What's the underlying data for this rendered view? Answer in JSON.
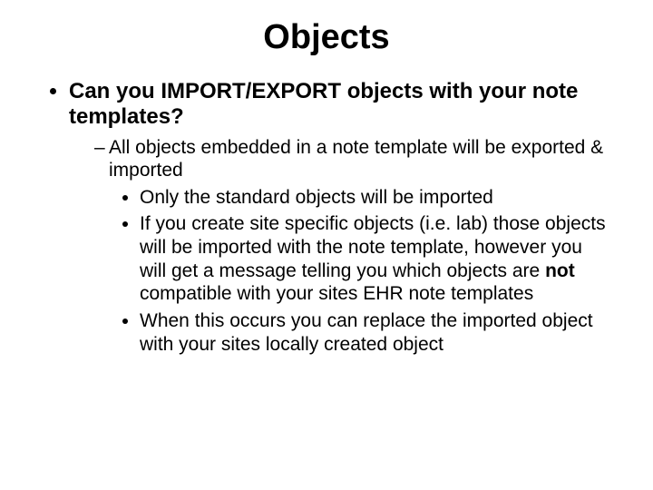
{
  "title": "Objects",
  "bullet1": "Can you IMPORT/EXPORT objects with your note templates?",
  "sub1": "All objects embedded in a note template will be exported & imported",
  "subsub1": "Only the standard objects will be imported",
  "subsub2_pre": "If you create site specific objects (i.e. lab) those objects will be imported with the note template, however you will get a message telling you which objects are ",
  "subsub2_bold": "not",
  "subsub2_post": " compatible with your sites EHR note templates",
  "subsub3": "When this occurs you can replace the imported object with your sites locally created object"
}
